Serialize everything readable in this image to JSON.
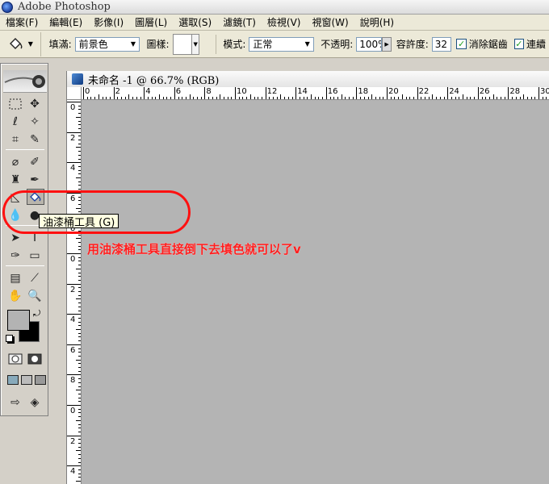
{
  "app": {
    "title": "Adobe Photoshop"
  },
  "menu": [
    "檔案(F)",
    "編輯(E)",
    "影像(I)",
    "圖層(L)",
    "選取(S)",
    "濾鏡(T)",
    "檢視(V)",
    "視窗(W)",
    "說明(H)"
  ],
  "options": {
    "fill_label": "填滿:",
    "fill_value": "前景色",
    "pattern_label": "圖樣:",
    "mode_label": "模式:",
    "mode_value": "正常",
    "opacity_label": "不透明:",
    "opacity_value": "100%",
    "tolerance_label": "容許度:",
    "tolerance_value": "32",
    "antialias_label": "消除鋸齒",
    "contiguous_label": "連續"
  },
  "document": {
    "title": "未命名 -1 @ 66.7% (RGB)",
    "h_ruler": [
      "0",
      "2",
      "4",
      "6",
      "8",
      "10",
      "12",
      "14",
      "16",
      "18",
      "20",
      "22",
      "24",
      "26",
      "28",
      "30"
    ],
    "v_ruler": [
      "0",
      "2",
      "4",
      "6",
      "8",
      "0",
      "2",
      "4",
      "6",
      "8",
      "0",
      "2",
      "4"
    ]
  },
  "tooltip": "油漆桶工具 (G)",
  "annotation": "用油漆桶工具直接倒下去填色就可以了v",
  "colors": {
    "foreground": "#b3b3b3",
    "background": "#000000",
    "annotation": "#ff1e1e"
  }
}
